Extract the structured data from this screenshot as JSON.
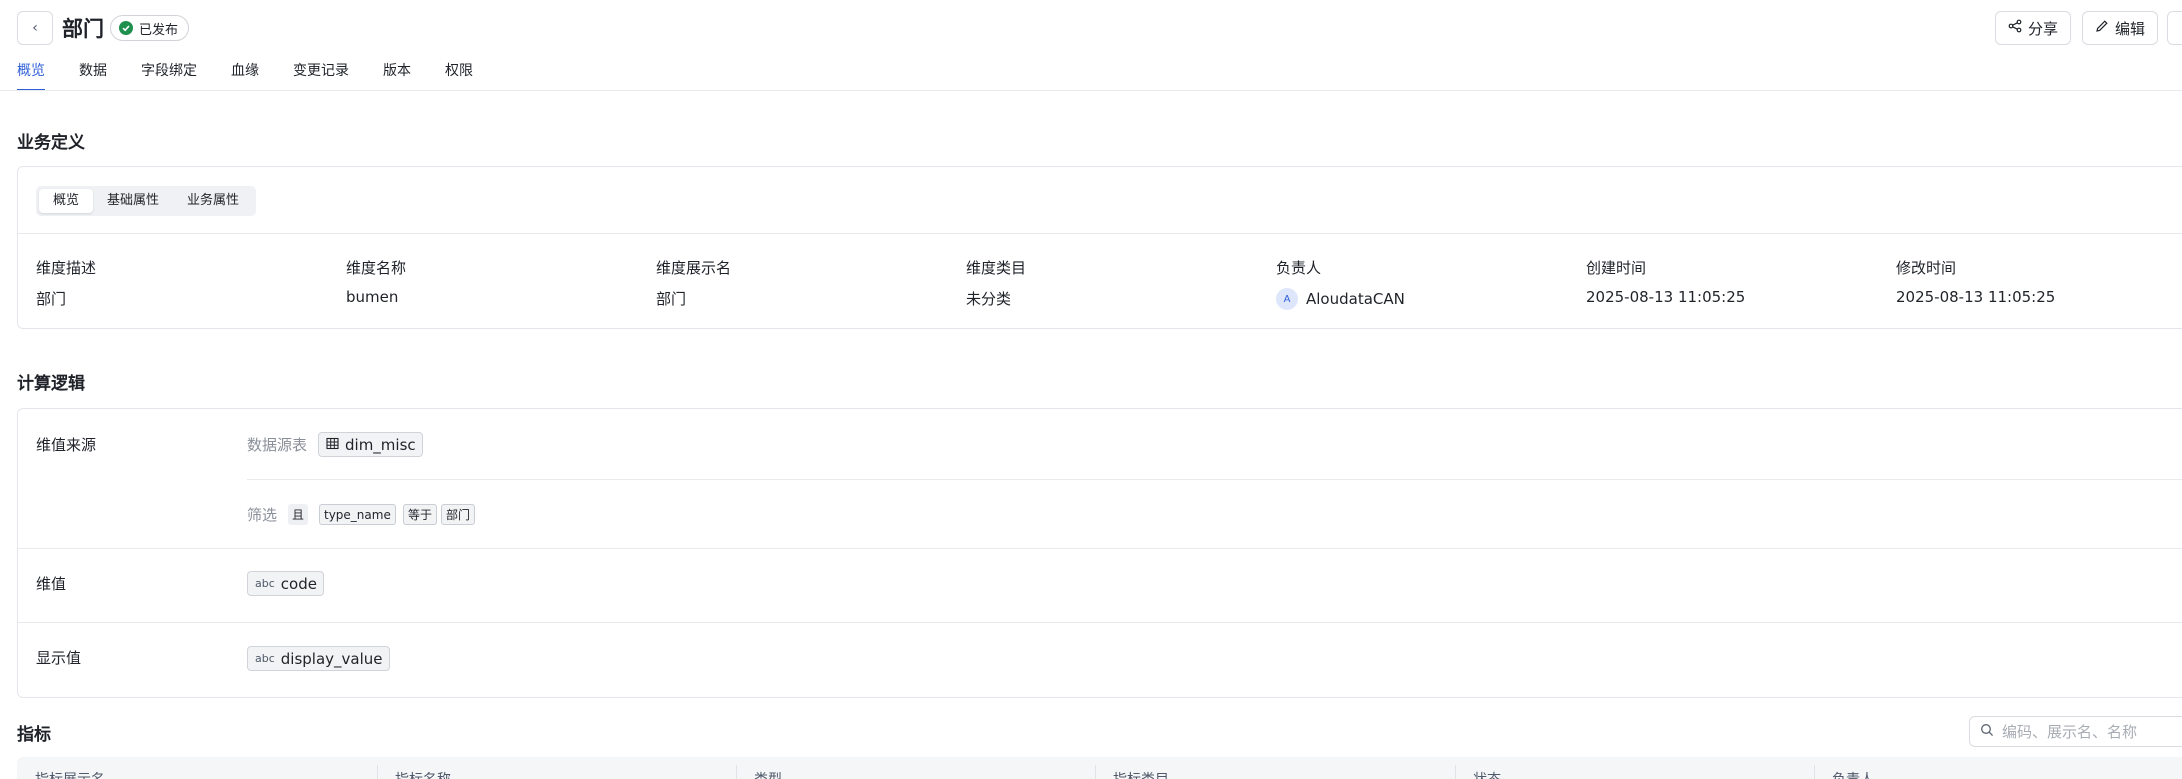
{
  "header": {
    "title": "部门",
    "status": "已发布",
    "share_label": "分享",
    "edit_label": "编辑"
  },
  "tabs": [
    {
      "label": "概览",
      "active": true
    },
    {
      "label": "数据"
    },
    {
      "label": "字段绑定"
    },
    {
      "label": "血缘"
    },
    {
      "label": "变更记录"
    },
    {
      "label": "版本"
    },
    {
      "label": "权限"
    }
  ],
  "business": {
    "title": "业务定义",
    "segments": [
      "概览",
      "基础属性",
      "业务属性"
    ],
    "attributes": [
      {
        "label": "维度描述",
        "value": "部门"
      },
      {
        "label": "维度名称",
        "value": "bumen"
      },
      {
        "label": "维度展示名",
        "value": "部门"
      },
      {
        "label": "维度类目",
        "value": "未分类"
      },
      {
        "label": "负责人",
        "value": "AloudataCAN",
        "avatar": "A"
      },
      {
        "label": "创建时间",
        "value": "2025-08-13 11:05:25"
      },
      {
        "label": "修改时间",
        "value": "2025-08-13 11:05:25"
      }
    ]
  },
  "logic": {
    "title": "计算逻辑",
    "source_label": "维值来源",
    "table_label": "数据源表",
    "table_name": "dim_misc",
    "filter_label": "筛选",
    "filter_tags": [
      "且",
      "type_name",
      "等于",
      "部门"
    ],
    "value_label": "维值",
    "value_field": "code",
    "display_label": "显示值",
    "display_field": "display_value",
    "field_type_glyph": "abc"
  },
  "metrics": {
    "title": "指标",
    "search_placeholder": "编码、展示名、名称",
    "columns": [
      "指标展示名",
      "指标名称",
      "类型",
      "指标类目",
      "状态",
      "负责人"
    ]
  },
  "colors": {
    "accent": "#2f5fd7",
    "published": "#1f8f4e"
  }
}
